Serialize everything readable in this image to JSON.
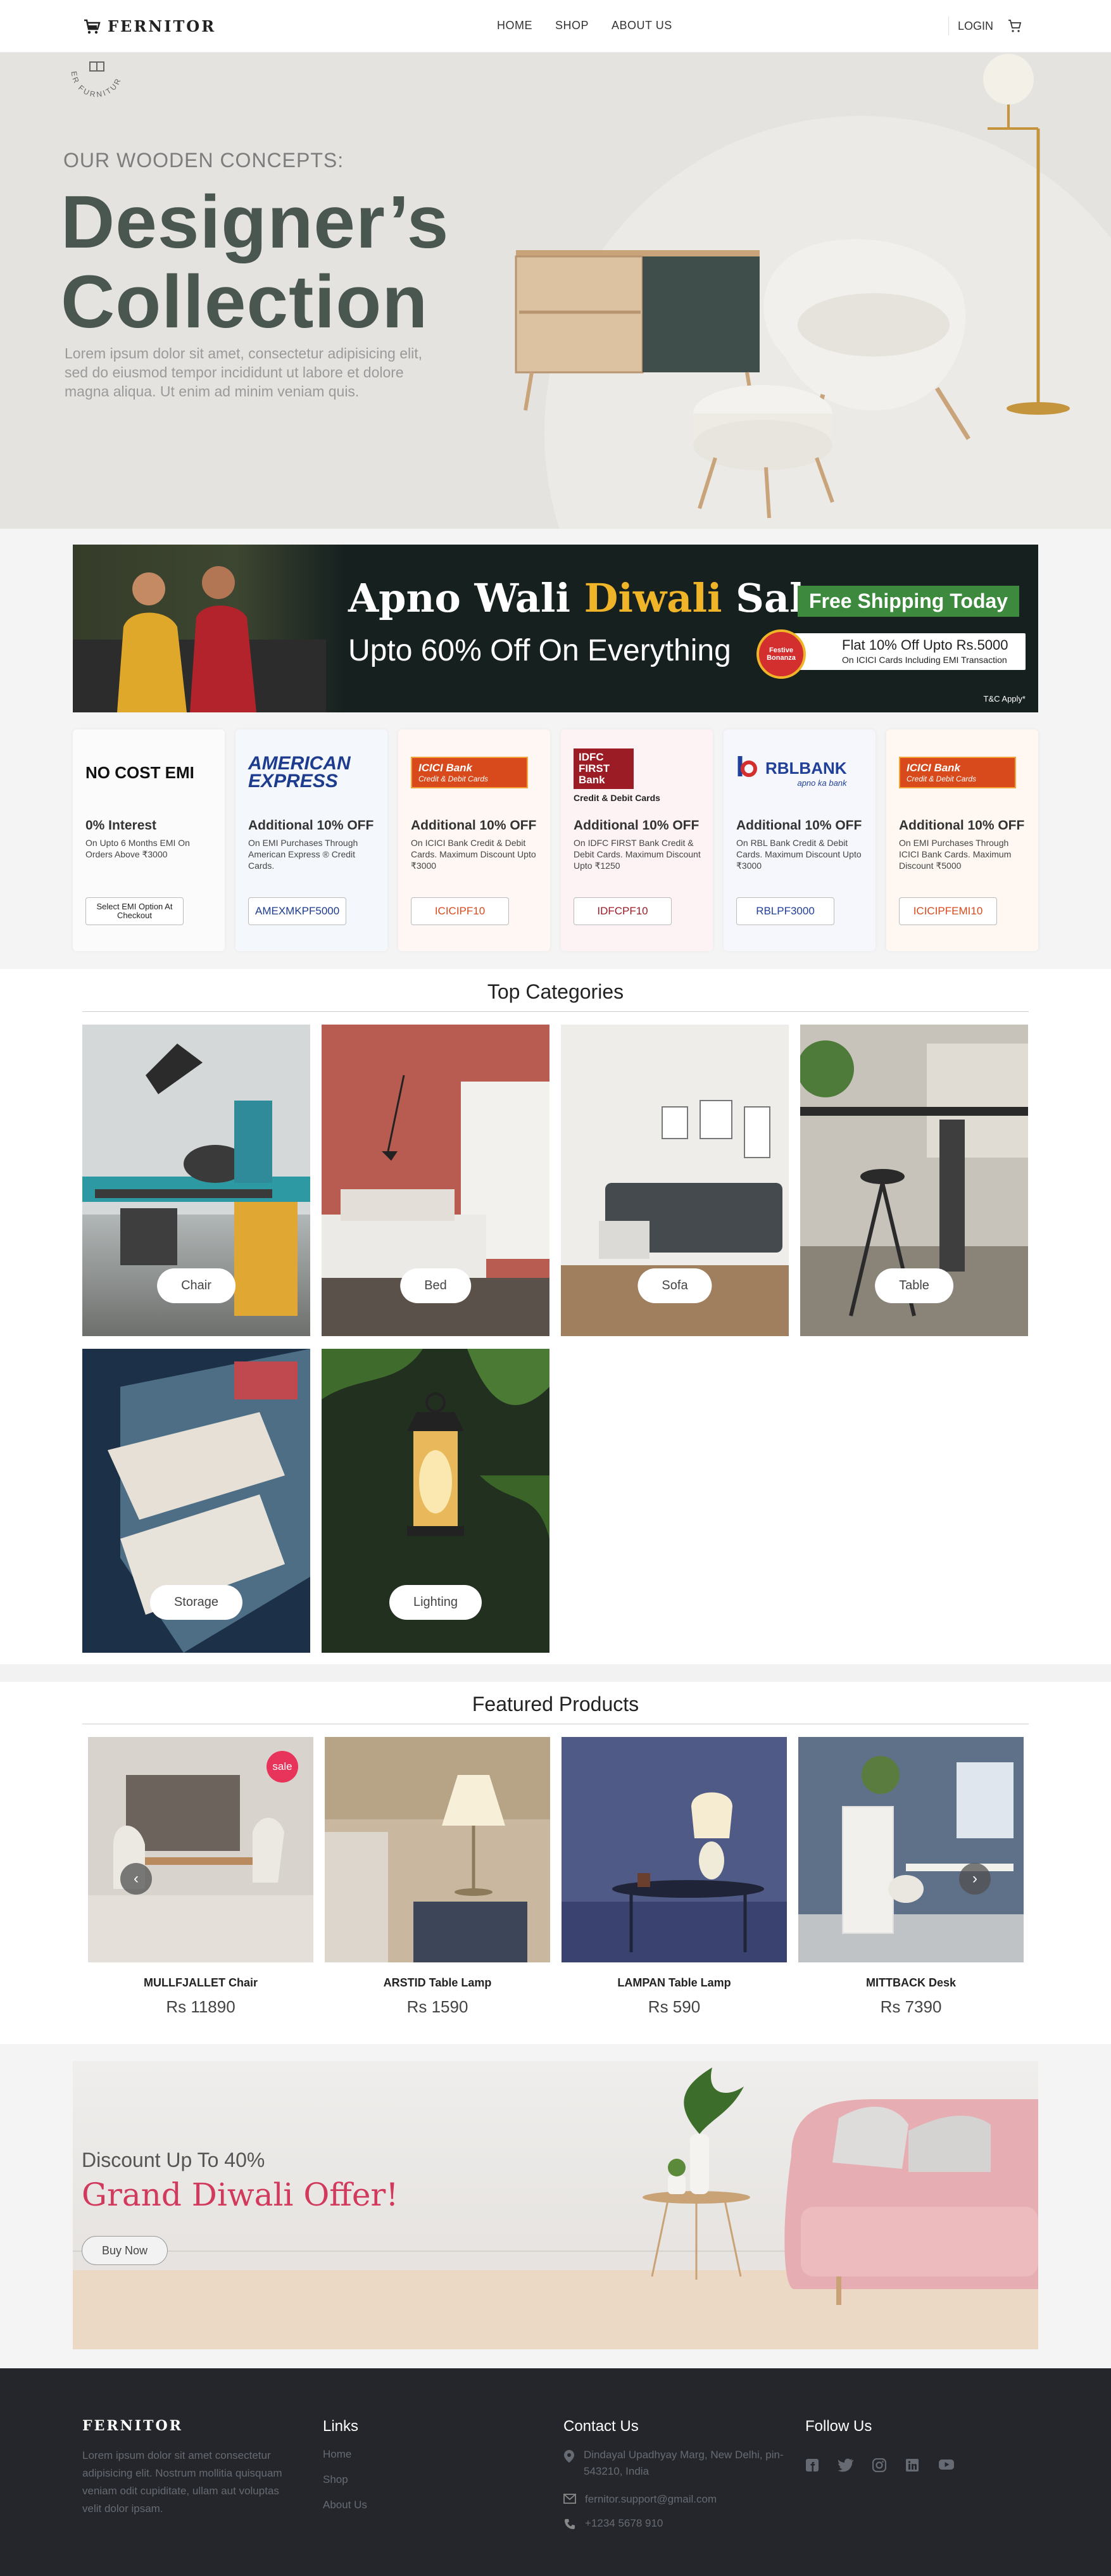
{
  "header": {
    "brand": "FERNITOR",
    "nav": [
      "HOME",
      "SHOP",
      "ABOUT US"
    ],
    "login": "LOGIN"
  },
  "hero": {
    "stamp_text": "ER FURNITUR",
    "subtitle": "OUR WOODEN CONCEPTS:",
    "title_line1": "Designer’s",
    "title_line2": "Collection",
    "description": "Lorem ipsum dolor sit amet, consectetur adipisicing elit, sed do eiusmod tempor incididunt ut labore et dolore magna aliqua. Ut enim ad minim veniam quis."
  },
  "diwali": {
    "title_start": "Apno Wali ",
    "title_highlight": "Diwali",
    "title_end": " Sale",
    "upto": "Upto 60% Off On Everything",
    "free_shipping": "Free Shipping Today",
    "festive_badge": "Festive Bonanza",
    "offer_line1": "Flat 10% Off Upto Rs.5000",
    "offer_line2": "On ICICI Cards Including EMI Transaction",
    "tc": "T&C Apply*",
    "colors": {
      "highlight": "#f0b429",
      "green": "#3d8a3e"
    }
  },
  "emi_cards": [
    {
      "logo": "NO COST EMI",
      "title": "0% Interest",
      "desc": "On Upto 6 Months EMI On Orders Above ₹3000",
      "code": "Select EMI Option At Checkout"
    },
    {
      "logo": "AMERICAN EXPRESS",
      "title": "Additional 10% OFF",
      "desc": "On EMI Purchases Through American Express ® Credit Cards.",
      "code": "AMEXMKPF5000"
    },
    {
      "logo": "ICICI Bank",
      "logo_sub": "Credit & Debit Cards",
      "title": "Additional 10% OFF",
      "desc": "On ICICI Bank Credit & Debit Cards. Maximum Discount Upto ₹3000",
      "code": "ICICIPF10"
    },
    {
      "logo": "IDFC FIRST Bank",
      "logo_sub": "Credit & Debit Cards",
      "title": "Additional 10% OFF",
      "desc": "On IDFC FIRST Bank Credit & Debit Cards. Maximum Discount  Upto ₹1250",
      "code": "IDFCPF10"
    },
    {
      "logo": "RBLBANK",
      "logo_sub": "apno ka bank",
      "title": "Additional 10% OFF",
      "desc": "On RBL Bank Credit & Debit Cards. Maximum Discount Upto ₹3000",
      "code": "RBLPF3000"
    },
    {
      "logo": "ICICI Bank",
      "logo_sub": "Credit & Debit Cards",
      "title": "Additional 10% OFF",
      "desc": "On EMI Purchases Through ICICI Bank Cards. Maximum Discount ₹5000",
      "code": "ICICIPFEMI10"
    }
  ],
  "categories": {
    "title": "Top Categories",
    "items": [
      "Chair",
      "Bed",
      "Sofa",
      "Table",
      "Storage",
      "Lighting"
    ]
  },
  "featured": {
    "title": "Featured Products",
    "sale_badge": "sale",
    "items": [
      {
        "name": "MULLFJALLET Chair",
        "price": "Rs 11890"
      },
      {
        "name": "ARSTID Table Lamp",
        "price": "Rs 1590"
      },
      {
        "name": "LAMPAN Table Lamp",
        "price": "Rs 590"
      },
      {
        "name": "MITTBACK Desk",
        "price": "Rs 7390"
      }
    ]
  },
  "offer": {
    "subtitle": "Discount Up To 40%",
    "title": "Grand Diwali Offer!",
    "button": "Buy Now",
    "title_color": "#d13a5c"
  },
  "footer": {
    "brand": "FERNITOR",
    "about": "Lorem ipsum dolor sit amet consectetur adipisicing elit. Nostrum mollitia quisquam veniam odit cupiditate, ullam aut voluptas velit dolor ipsam.",
    "links_title": "Links",
    "links": [
      "Home",
      "Shop",
      "About Us"
    ],
    "contact_title": "Contact Us",
    "address": "Dindayal Upadhyay Marg, New Delhi, pin-543210, India",
    "email": "fernitor.support@gmail.com",
    "phone": "+1234 5678 910",
    "follow_title": "Follow Us",
    "social_icons": [
      "facebook-icon",
      "twitter-icon",
      "instagram-icon",
      "linkedin-icon",
      "youtube-icon"
    ]
  }
}
